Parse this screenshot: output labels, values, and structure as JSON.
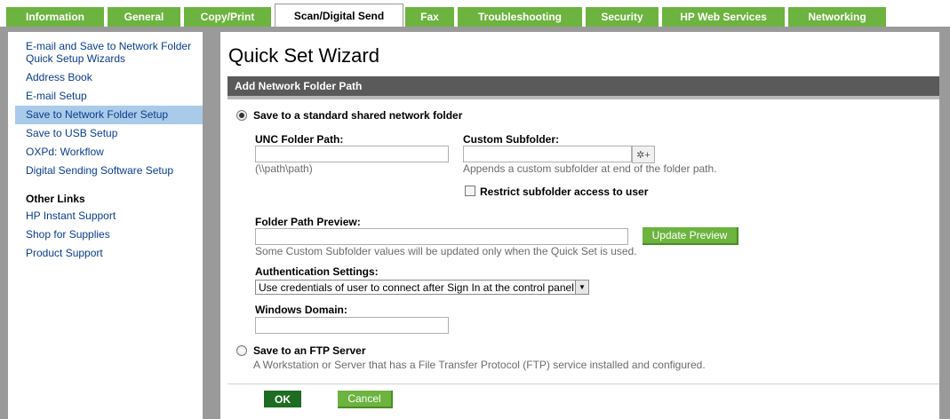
{
  "tabs": [
    {
      "label": "Information",
      "active": false
    },
    {
      "label": "General",
      "active": false
    },
    {
      "label": "Copy/Print",
      "active": false
    },
    {
      "label": "Scan/Digital Send",
      "active": true
    },
    {
      "label": "Fax",
      "active": false
    },
    {
      "label": "Troubleshooting",
      "active": false
    },
    {
      "label": "Security",
      "active": false
    },
    {
      "label": "HP Web Services",
      "active": false
    },
    {
      "label": "Networking",
      "active": false
    }
  ],
  "sidebar": {
    "items": [
      {
        "label": "E-mail and Save to Network Folder Quick Setup Wizards",
        "selected": false
      },
      {
        "label": "Address Book",
        "selected": false
      },
      {
        "label": "E-mail Setup",
        "selected": false
      },
      {
        "label": "Save to Network Folder Setup",
        "selected": true
      },
      {
        "label": "Save to USB Setup",
        "selected": false
      },
      {
        "label": "OXPd: Workflow",
        "selected": false
      },
      {
        "label": "Digital Sending Software Setup",
        "selected": false
      }
    ],
    "other_links_heading": "Other Links",
    "other_links": [
      {
        "label": "HP Instant Support"
      },
      {
        "label": "Shop for Supplies"
      },
      {
        "label": "Product Support"
      }
    ]
  },
  "main": {
    "title": "Quick Set Wizard",
    "section_title": "Add Network Folder Path",
    "option_standard": {
      "label": "Save to a standard shared network folder",
      "checked": true
    },
    "unc": {
      "label": "UNC Folder Path:",
      "value": "",
      "hint": "(\\\\path\\path)"
    },
    "custom_subfolder": {
      "label": "Custom Subfolder:",
      "value": "",
      "hint": "Appends a custom subfolder at end of the folder path.",
      "icon": "gear-plus-icon"
    },
    "restrict": {
      "label": "Restrict subfolder access to user",
      "checked": false
    },
    "preview": {
      "label": "Folder Path Preview:",
      "value": "",
      "hint": "Some Custom Subfolder values will be updated only when the Quick Set is used.",
      "button": "Update Preview"
    },
    "auth": {
      "label": "Authentication Settings:",
      "selected": "Use credentials of user to connect after Sign In at the control panel"
    },
    "domain": {
      "label": "Windows Domain:",
      "value": ""
    },
    "option_ftp": {
      "label": "Save to an FTP Server",
      "checked": false,
      "description": "A Workstation or Server that has a File Transfer Protocol (FTP) service installed and configured."
    },
    "ok_label": "OK",
    "cancel_label": "Cancel"
  },
  "colors": {
    "tab_green": "#6cb33f",
    "section_bar": "#5a5a5a",
    "sidebar_selected": "#a9cbe9",
    "link_blue": "#0a3c8c",
    "ok_dark_green": "#1e6b23"
  }
}
